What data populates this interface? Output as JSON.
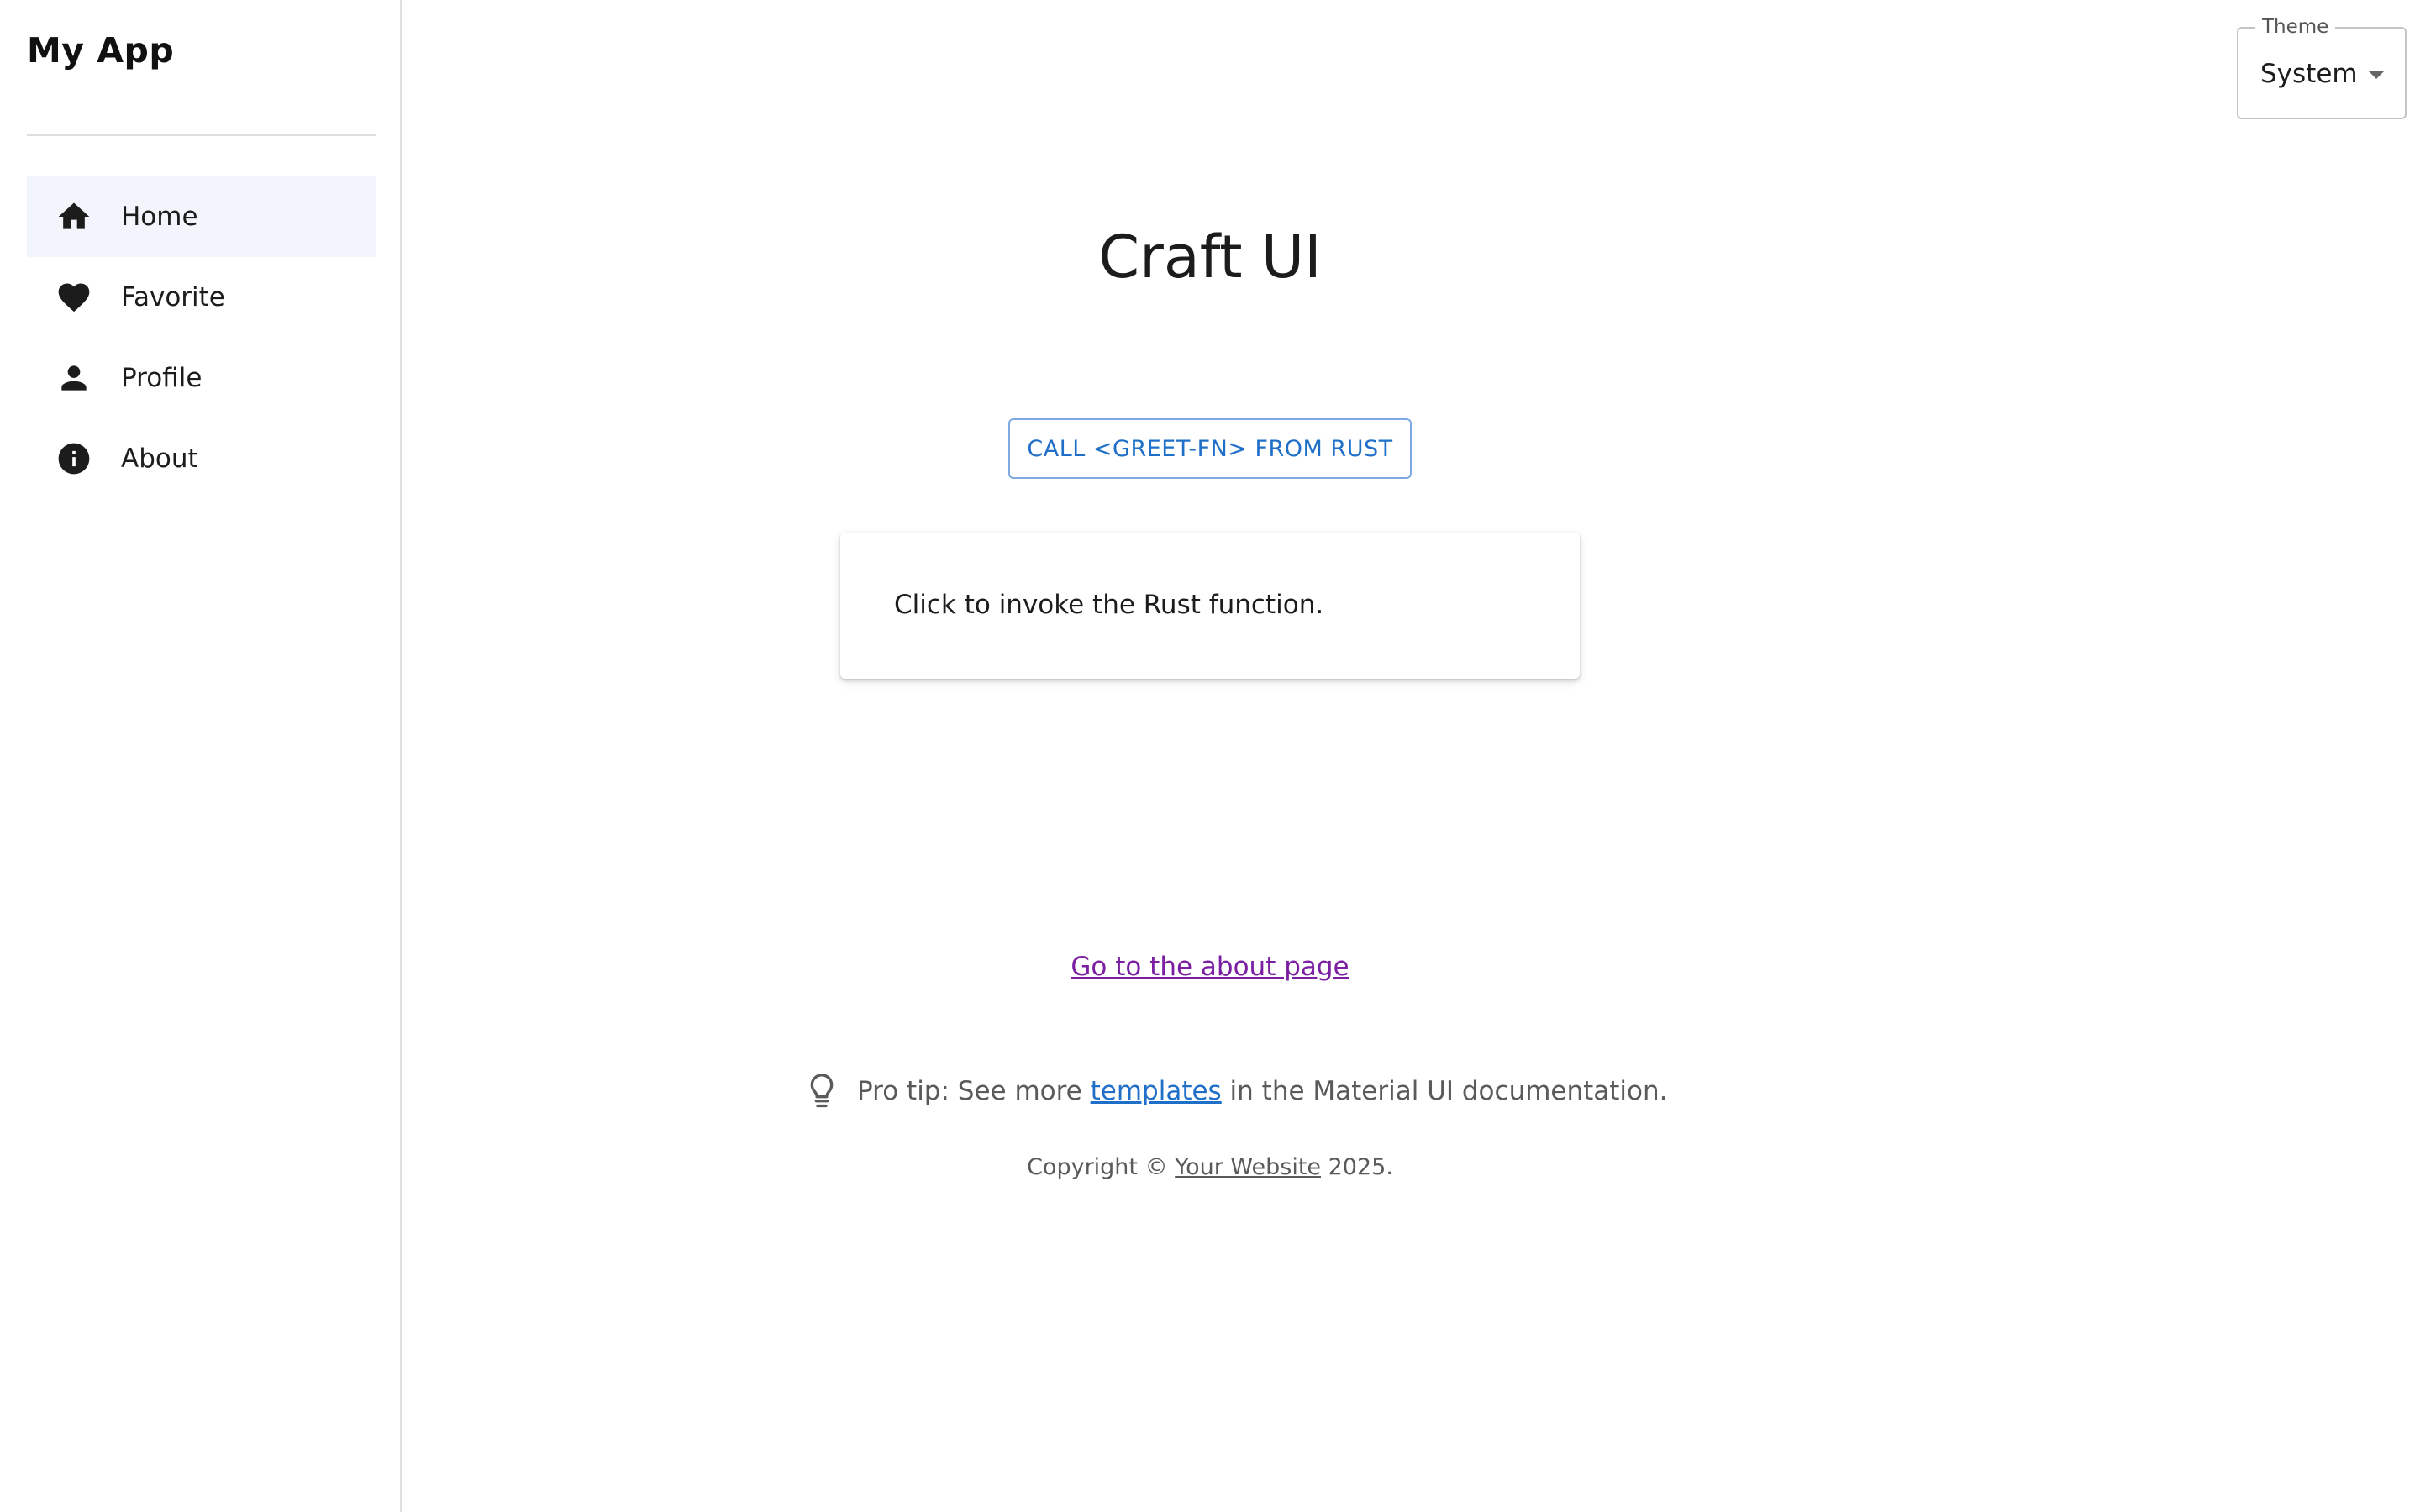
{
  "sidebar": {
    "app_title": "My App",
    "items": [
      {
        "label": "Home",
        "icon": "home-icon",
        "selected": true
      },
      {
        "label": "Favorite",
        "icon": "heart-icon",
        "selected": false
      },
      {
        "label": "Profile",
        "icon": "person-icon",
        "selected": false
      },
      {
        "label": "About",
        "icon": "info-icon",
        "selected": false
      }
    ]
  },
  "theme": {
    "label": "Theme",
    "value": "System"
  },
  "main": {
    "title": "Craft UI",
    "call_button_label": "CALL <GREET-FN> FROM RUST",
    "result_text": "Click to invoke the Rust function.",
    "about_link": "Go to the about page",
    "pro_tip": {
      "prefix": "Pro tip: See more ",
      "link": "templates",
      "suffix": " in the Material UI documentation."
    },
    "copyright": {
      "prefix": "Copyright © ",
      "link": "Your Website",
      "suffix": " 2025."
    }
  },
  "colors": {
    "accent": "#1f6fc9",
    "visited_link": "#7b1fa2",
    "selected_bg": "#f2f5fb"
  }
}
